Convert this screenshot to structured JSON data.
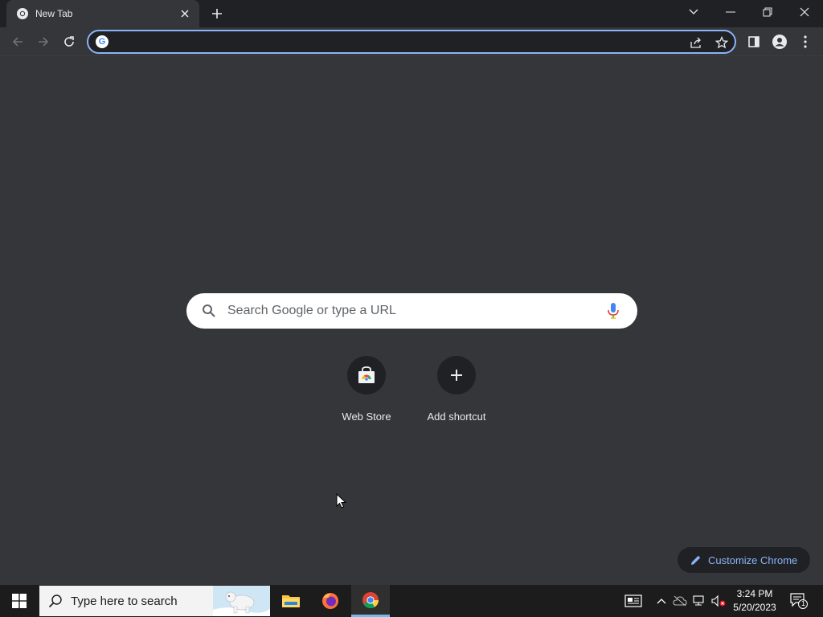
{
  "browser": {
    "tab": {
      "title": "New Tab"
    },
    "omnibox": {
      "value": ""
    }
  },
  "ntp": {
    "search_placeholder": "Search Google or type a URL",
    "shortcuts": [
      {
        "label": "Web Store",
        "icon": "web-store-icon"
      },
      {
        "label": "Add shortcut",
        "icon": "plus-icon"
      }
    ],
    "customize_label": "Customize Chrome"
  },
  "taskbar": {
    "search_placeholder": "Type here to search",
    "apps": [
      "file-explorer",
      "firefox",
      "chrome"
    ],
    "time": "3:24 PM",
    "date": "5/20/2023",
    "notification_count": "1"
  },
  "colors": {
    "tab_strip": "#202124",
    "toolbar": "#35363a",
    "page_bg": "#35363a",
    "accent": "#8ab4f8",
    "taskbar": "#1c1c1c"
  }
}
